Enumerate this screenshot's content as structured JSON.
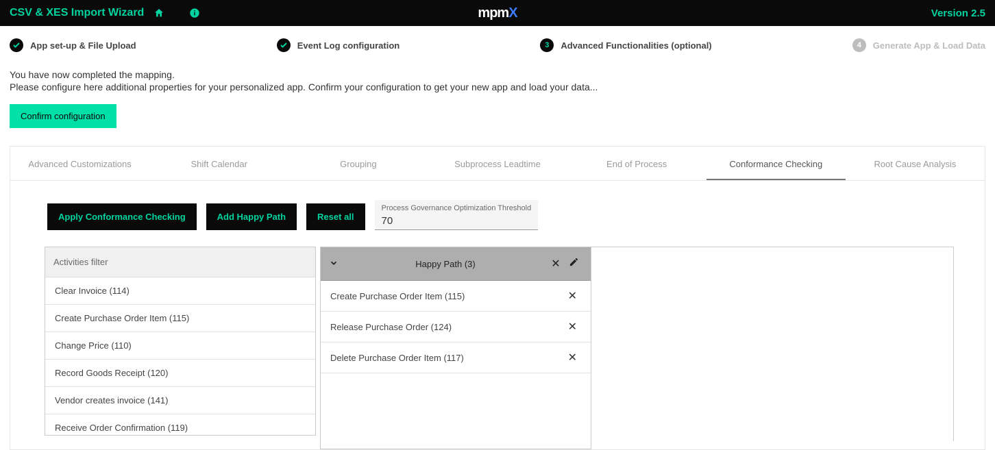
{
  "topbar": {
    "title": "CSV & XES Import Wizard",
    "version": "Version 2.5",
    "logo_main": "mpm",
    "logo_x": "X"
  },
  "stepper": {
    "s1": "App set-up & File Upload",
    "s2": "Event Log configuration",
    "s3": "Advanced Functionalities (optional)",
    "s3_num": "3",
    "s4": "Generate App & Load Data",
    "s4_num": "4"
  },
  "intro": {
    "line1": "You have now completed the mapping.",
    "line2": "Please configure here additional properties for your personalized app. Confirm your configuration to get your new app and load your data...",
    "confirm": "Confirm configuration"
  },
  "tabs": {
    "t1": "Advanced Customizations",
    "t2": "Shift Calendar",
    "t3": "Grouping",
    "t4": "Subprocess Leadtime",
    "t5": "End of Process",
    "t6": "Conformance Checking",
    "t7": "Root Cause Analysis"
  },
  "buttons": {
    "apply": "Apply Conformance Checking",
    "addhp": "Add Happy Path",
    "reset": "Reset all"
  },
  "threshold": {
    "label": "Process Governance Optimization Threshold",
    "value": "70"
  },
  "activities": {
    "header": "Activities filter",
    "items": [
      "Clear Invoice (114)",
      "Create Purchase Order Item (115)",
      "Change Price (110)",
      "Record Goods Receipt (120)",
      "Vendor creates invoice (141)",
      "Receive Order Confirmation (119)"
    ]
  },
  "happypath": {
    "title": "Happy Path (3)",
    "items": [
      "Create Purchase Order Item (115)",
      "Release Purchase Order (124)",
      "Delete Purchase Order Item (117)"
    ]
  }
}
